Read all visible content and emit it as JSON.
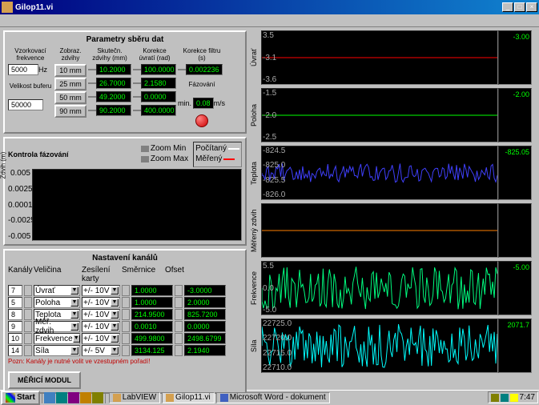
{
  "window": {
    "title": "Gilop11.vi"
  },
  "params_title": "Parametry sběru dat",
  "left": {
    "vzorkovaci_label": "Vzorkovací\nfrekvence",
    "vzorkovaci_value": "5000",
    "vzorkovaci_unit": "Hz",
    "velikost_label": "Velikost\nbuferu",
    "velikost_value": "50000",
    "col_headers": [
      "Zobraz.\nzdvihy",
      "Skutečn.\nzdvihy (mm)",
      "Korekce\núvratí (rad)",
      "Korekce filtru\n(s)"
    ],
    "zdvih_rows": [
      {
        "btn": "10 mm",
        "skut": "10.2000",
        "kor": "100.0000"
      },
      {
        "btn": "25 mm",
        "skut": "26.7000",
        "kor": "2.1580"
      },
      {
        "btn": "50 mm",
        "skut": "49.2000",
        "kor": "0.0000"
      },
      {
        "btn": "90 mm",
        "skut": "90.2000",
        "kor": "400.0000"
      }
    ],
    "korekce_filtru": "0.002236",
    "fazovani_label": "Fázování",
    "fazovani_min": "min.",
    "fazovani_val": "0.08",
    "fazovani_unit": "m/s"
  },
  "kontrola": {
    "title": "Kontrola fázování",
    "zoom_min": "Zoom Min",
    "zoom_max": "Zoom Max",
    "legend1": "Počítaný",
    "legend2": "Měřený",
    "yaxis_label": "Zdvih (m)",
    "yticks": [
      "0.005",
      "0.0025",
      "0.00011",
      "-0.0025",
      "-0.005"
    ]
  },
  "nastaveni": {
    "title": "Nastavení kanálů",
    "headers": [
      "Kanály",
      "Veličina",
      "Zesílení karty",
      "Směrnice",
      "Ofset"
    ],
    "rows": [
      {
        "num": "7",
        "vel": "Úvrať",
        "zes": "+/- 10V",
        "smer": "1.0000",
        "off": "-3.0000"
      },
      {
        "num": "5",
        "vel": "Poloha",
        "zes": "+/- 10V",
        "smer": "1.0000",
        "off": "2.0000"
      },
      {
        "num": "8",
        "vel": "Teplota",
        "zes": "+/- 10V",
        "smer": "214.9500",
        "off": "825.7200"
      },
      {
        "num": "9",
        "vel": "Měř. zdvih",
        "zes": "+/- 10V",
        "smer": "0.0010",
        "off": "0.0000"
      },
      {
        "num": "10",
        "vel": "Frekvence",
        "zes": "+/- 10V",
        "smer": "499.9800",
        "off": "2498.6799"
      },
      {
        "num": "14",
        "vel": "Síla",
        "zes": "+/- 5V",
        "smer": "3134.125",
        "off": "2.1940"
      }
    ],
    "warning": "Pozn: Kanály je nutné volit ve vzestupném pořadí!",
    "button": "MĚŘICÍ MODUL"
  },
  "signals": [
    {
      "name": "Úvrať",
      "value": "-3.00",
      "color": "#ff0000",
      "style": "flat",
      "yticks": [
        "3.5",
        "-3.1",
        "-3.6"
      ]
    },
    {
      "name": "Poloha",
      "value": "-2.00",
      "color": "#00ff00",
      "style": "flat",
      "yticks": [
        "-1.5",
        "-2.0",
        "-2.5"
      ]
    },
    {
      "name": "Teplota",
      "value": "-825.05",
      "color": "#4040ff",
      "style": "noise",
      "yticks": [
        "-824.5",
        "-825.0",
        "-825.5",
        "-826.0"
      ]
    },
    {
      "name": "Měřený zdvih",
      "value": "",
      "color": "#ff8000",
      "style": "flat",
      "yticks": [
        "",
        "",
        ""
      ]
    },
    {
      "name": "Frekvence",
      "value": "-5.00",
      "color": "#00ff80",
      "style": "bignoise",
      "yticks": [
        "5.5",
        "0.0",
        "-5.0"
      ]
    },
    {
      "name": "Síla",
      "value": "2071.7",
      "color": "#00ffff",
      "style": "bignoise",
      "yticks": [
        "22725.0",
        "22720.0",
        "22715.0",
        "22710.0"
      ]
    }
  ],
  "taskbar": {
    "start": "Start",
    "tasks": [
      "LabVIEW",
      "Gilop11.vi",
      "Microsoft Word - dokument"
    ],
    "time": "7:47"
  },
  "chart_data": [
    {
      "type": "line",
      "title": "Úvrať",
      "series": [
        {
          "name": "Úvrať",
          "values_desc": "flat line at -3.00"
        }
      ],
      "ylim": [
        -3.6,
        3.5
      ]
    },
    {
      "type": "line",
      "title": "Poloha",
      "series": [
        {
          "name": "Poloha",
          "values_desc": "flat line at -2.00"
        }
      ],
      "ylim": [
        -2.5,
        -1.5
      ]
    },
    {
      "type": "line",
      "title": "Teplota",
      "series": [
        {
          "name": "Teplota",
          "values_desc": "noisy signal around -825"
        }
      ],
      "ylim": [
        -826,
        -824.5
      ]
    },
    {
      "type": "line",
      "title": "Měřený zdvih",
      "series": [
        {
          "name": "Měřený zdvih",
          "values_desc": "flat line near 0"
        }
      ],
      "ylim": [
        0,
        1
      ]
    },
    {
      "type": "line",
      "title": "Frekvence",
      "series": [
        {
          "name": "Frekvence",
          "values_desc": "large noise around 0"
        }
      ],
      "ylim": [
        -5,
        5.5
      ]
    },
    {
      "type": "line",
      "title": "Síla",
      "series": [
        {
          "name": "Síla",
          "values_desc": "large noise around 22717"
        }
      ],
      "ylim": [
        22710,
        22725
      ]
    }
  ]
}
